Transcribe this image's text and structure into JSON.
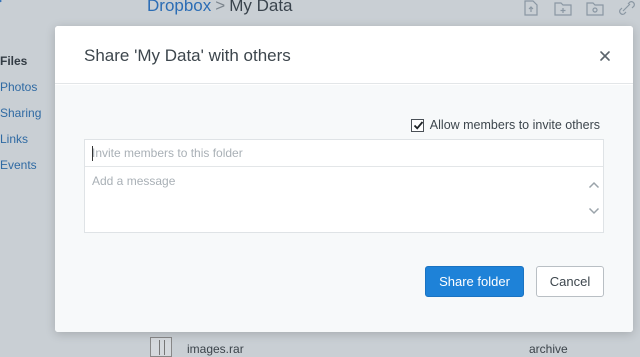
{
  "background": {
    "sidebar": {
      "items": [
        {
          "label": "Files",
          "active": true
        },
        {
          "label": "Photos"
        },
        {
          "label": "Sharing"
        },
        {
          "label": "Links"
        },
        {
          "label": "Events"
        }
      ]
    },
    "breadcrumb": {
      "root": "Dropbox",
      "separator": ">",
      "current": "My Data"
    },
    "toolbar": {
      "icons": [
        "upload-file-icon",
        "new-folder-icon",
        "shared-folder-icon",
        "link-icon"
      ]
    },
    "file_row": {
      "name": "images.rar",
      "kind": "archive",
      "icon": "archive-file-icon"
    }
  },
  "modal": {
    "title": "Share 'My Data' with others",
    "close_icon": "close-icon",
    "allow_invite": {
      "label": "Allow members to invite others",
      "checked": true
    },
    "invite_field": {
      "placeholder": "Invite members to this folder",
      "value": ""
    },
    "message_field": {
      "placeholder": "Add a message",
      "value": ""
    },
    "buttons": {
      "primary": "Share folder",
      "secondary": "Cancel"
    }
  },
  "colors": {
    "accent": "#1e82d8",
    "link": "#2b6db5",
    "backdrop": "#c9cfd4"
  }
}
